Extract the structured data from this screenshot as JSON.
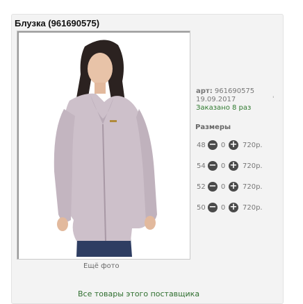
{
  "product": {
    "title": "Блузка (961690575)",
    "article_label": "арт:",
    "article_value": "961690575",
    "date": "19.09.2017",
    "ordered": "Заказано 8 раз",
    "more_photo": "Ещё фото",
    "sizes_header": "Размеры",
    "tick": "'"
  },
  "sizes": [
    {
      "size": "48",
      "qty": "0",
      "price": "720р."
    },
    {
      "size": "54",
      "qty": "0",
      "price": "720р."
    },
    {
      "size": "52",
      "qty": "0",
      "price": "720р."
    },
    {
      "size": "50",
      "qty": "0",
      "price": "720р."
    }
  ],
  "icons": {
    "minus": "−",
    "plus": "+"
  },
  "footer": {
    "supplier_link": "Все товары этого поставщика"
  },
  "colors": {
    "accent_green": "#2f7a2f",
    "button_dark": "#4a4a4a",
    "panel_bg": "#f3f3f3"
  }
}
